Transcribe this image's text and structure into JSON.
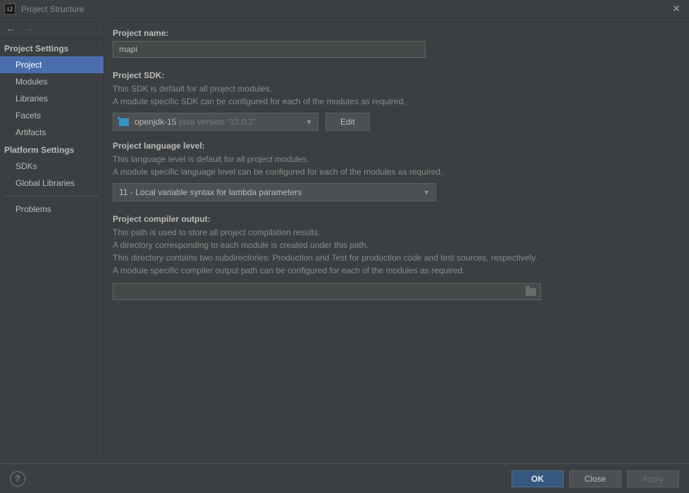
{
  "window": {
    "title": "Project Structure",
    "app_icon_letter": "IJ"
  },
  "sidebar": {
    "project_settings_header": "Project Settings",
    "project_settings": [
      {
        "label": "Project",
        "selected": true
      },
      {
        "label": "Modules",
        "selected": false
      },
      {
        "label": "Libraries",
        "selected": false
      },
      {
        "label": "Facets",
        "selected": false
      },
      {
        "label": "Artifacts",
        "selected": false
      }
    ],
    "platform_settings_header": "Platform Settings",
    "platform_settings": [
      {
        "label": "SDKs",
        "selected": false
      },
      {
        "label": "Global Libraries",
        "selected": false
      }
    ],
    "problems_label": "Problems"
  },
  "main": {
    "project_name_label": "Project name:",
    "project_name_value": "mapi",
    "project_sdk_label": "Project SDK:",
    "project_sdk_help1": "This SDK is default for all project modules.",
    "project_sdk_help2": "A module specific SDK can be configured for each of the modules as required.",
    "sdk_dropdown_name": "openjdk-15",
    "sdk_dropdown_version": "java version \"15.0.2\"",
    "edit_button": "Edit",
    "language_level_label": "Project language level:",
    "language_level_help1": "This language level is default for all project modules.",
    "language_level_help2": "A module specific language level can be configured for each of the modules as required.",
    "language_level_value": "11 - Local variable syntax for lambda parameters",
    "compiler_output_label": "Project compiler output:",
    "compiler_output_help1": "This path is used to store all project compilation results.",
    "compiler_output_help2": "A directory corresponding to each module is created under this path.",
    "compiler_output_help3": "This directory contains two subdirectories: Production and Test for production code and test sources, respectively.",
    "compiler_output_help4": "A module specific compiler output path can be configured for each of the modules as required.",
    "compiler_output_value": ""
  },
  "footer": {
    "ok": "OK",
    "close": "Close",
    "apply": "Apply"
  }
}
